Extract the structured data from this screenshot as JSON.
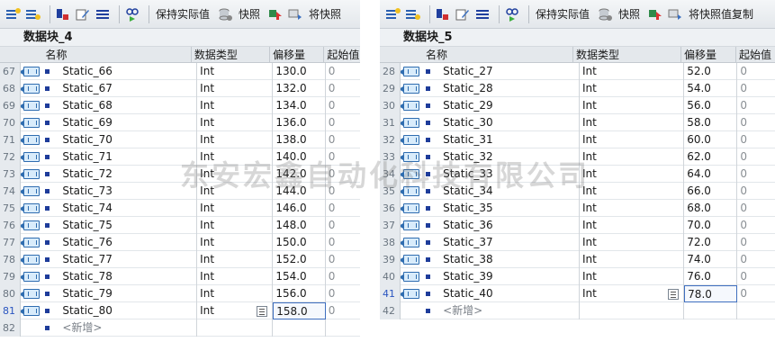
{
  "left": {
    "toolbar": {
      "keep_actual": "保持实际值",
      "snapshot": "快照",
      "to_snapshot": "将快照"
    },
    "block_title": "数据块_4",
    "headers": {
      "name": "名称",
      "type": "数据类型",
      "offset": "偏移量",
      "start": "起始值"
    },
    "rows": [
      {
        "num": "67",
        "name": "Static_66",
        "type": "Int",
        "offset": "130.0",
        "start": "0"
      },
      {
        "num": "68",
        "name": "Static_67",
        "type": "Int",
        "offset": "132.0",
        "start": "0"
      },
      {
        "num": "69",
        "name": "Static_68",
        "type": "Int",
        "offset": "134.0",
        "start": "0"
      },
      {
        "num": "70",
        "name": "Static_69",
        "type": "Int",
        "offset": "136.0",
        "start": "0"
      },
      {
        "num": "71",
        "name": "Static_70",
        "type": "Int",
        "offset": "138.0",
        "start": "0"
      },
      {
        "num": "72",
        "name": "Static_71",
        "type": "Int",
        "offset": "140.0",
        "start": "0"
      },
      {
        "num": "73",
        "name": "Static_72",
        "type": "Int",
        "offset": "142.0",
        "start": "0"
      },
      {
        "num": "74",
        "name": "Static_73",
        "type": "Int",
        "offset": "144.0",
        "start": "0"
      },
      {
        "num": "75",
        "name": "Static_74",
        "type": "Int",
        "offset": "146.0",
        "start": "0"
      },
      {
        "num": "76",
        "name": "Static_75",
        "type": "Int",
        "offset": "148.0",
        "start": "0"
      },
      {
        "num": "77",
        "name": "Static_76",
        "type": "Int",
        "offset": "150.0",
        "start": "0"
      },
      {
        "num": "78",
        "name": "Static_77",
        "type": "Int",
        "offset": "152.0",
        "start": "0"
      },
      {
        "num": "79",
        "name": "Static_78",
        "type": "Int",
        "offset": "154.0",
        "start": "0"
      },
      {
        "num": "80",
        "name": "Static_79",
        "type": "Int",
        "offset": "156.0",
        "start": "0"
      },
      {
        "num": "81",
        "name": "Static_80",
        "type": "Int",
        "offset": "158.0",
        "start": "0"
      }
    ],
    "new_row": {
      "num": "82",
      "label": "<新增>"
    }
  },
  "right": {
    "toolbar": {
      "keep_actual": "保持实际值",
      "snapshot": "快照",
      "to_snapshot": "将快照值复制"
    },
    "block_title": "数据块_5",
    "headers": {
      "name": "名称",
      "type": "数据类型",
      "offset": "偏移量",
      "start": "起始值"
    },
    "rows": [
      {
        "num": "28",
        "name": "Static_27",
        "type": "Int",
        "offset": "52.0",
        "start": "0"
      },
      {
        "num": "29",
        "name": "Static_28",
        "type": "Int",
        "offset": "54.0",
        "start": "0"
      },
      {
        "num": "30",
        "name": "Static_29",
        "type": "Int",
        "offset": "56.0",
        "start": "0"
      },
      {
        "num": "31",
        "name": "Static_30",
        "type": "Int",
        "offset": "58.0",
        "start": "0"
      },
      {
        "num": "32",
        "name": "Static_31",
        "type": "Int",
        "offset": "60.0",
        "start": "0"
      },
      {
        "num": "33",
        "name": "Static_32",
        "type": "Int",
        "offset": "62.0",
        "start": "0"
      },
      {
        "num": "34",
        "name": "Static_33",
        "type": "Int",
        "offset": "64.0",
        "start": "0"
      },
      {
        "num": "35",
        "name": "Static_34",
        "type": "Int",
        "offset": "66.0",
        "start": "0"
      },
      {
        "num": "36",
        "name": "Static_35",
        "type": "Int",
        "offset": "68.0",
        "start": "0"
      },
      {
        "num": "37",
        "name": "Static_36",
        "type": "Int",
        "offset": "70.0",
        "start": "0"
      },
      {
        "num": "38",
        "name": "Static_37",
        "type": "Int",
        "offset": "72.0",
        "start": "0"
      },
      {
        "num": "39",
        "name": "Static_38",
        "type": "Int",
        "offset": "74.0",
        "start": "0"
      },
      {
        "num": "40",
        "name": "Static_39",
        "type": "Int",
        "offset": "76.0",
        "start": "0"
      },
      {
        "num": "41",
        "name": "Static_40",
        "type": "Int",
        "offset": "78.0",
        "start": "0"
      }
    ],
    "new_row": {
      "num": "42",
      "label": "<新增>"
    }
  },
  "watermark": "东安宏鑫自动化科技有限公司",
  "colors": {
    "accent": "#1e3c9a",
    "selection_border": "#3f6fbf",
    "header_bg": "#e4e8ec"
  }
}
